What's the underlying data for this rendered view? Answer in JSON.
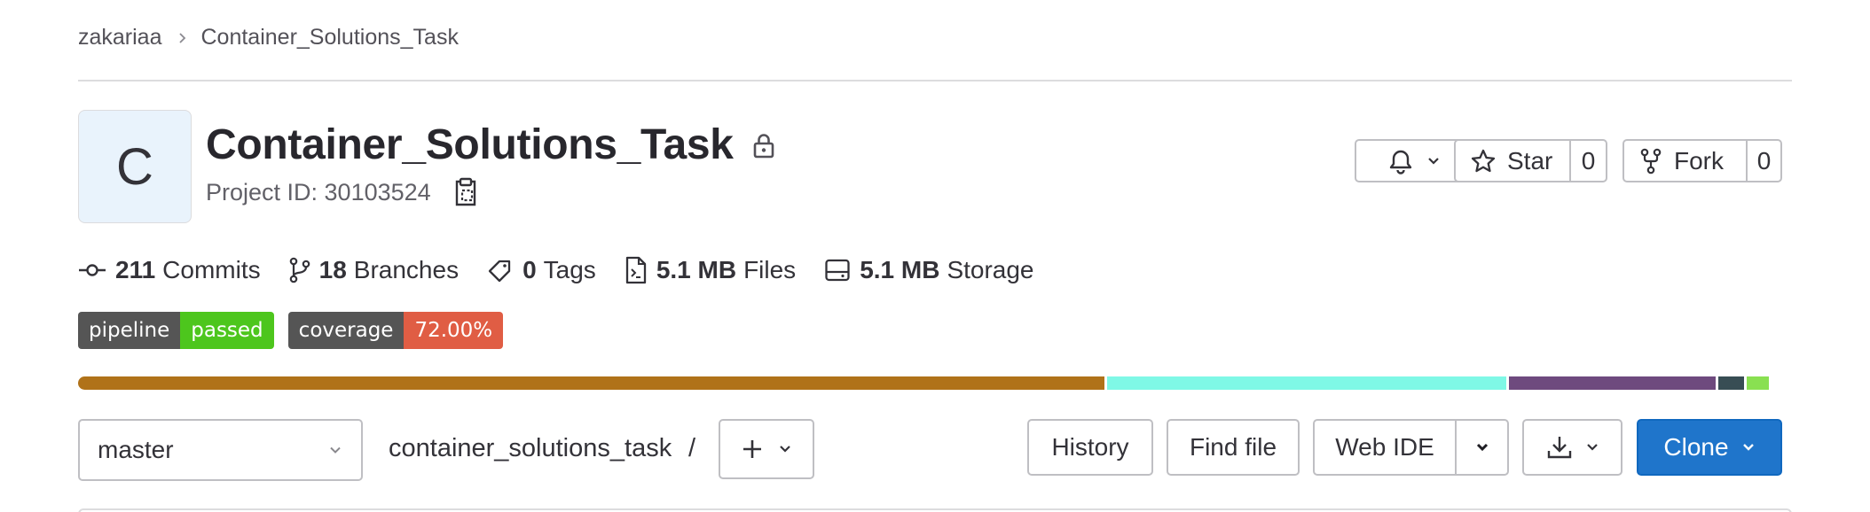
{
  "breadcrumb": {
    "owner": "zakariaa",
    "project": "Container_Solutions_Task"
  },
  "project": {
    "avatar_letter": "C",
    "title": "Container_Solutions_Task",
    "id_text": "Project ID: 30103524",
    "visibility_icon": "lock-icon"
  },
  "actions": {
    "notifications_icon": "bell-icon",
    "star_label": "Star",
    "star_count": "0",
    "fork_label": "Fork",
    "fork_count": "0"
  },
  "stats": {
    "commits_count": "211",
    "commits_label": "Commits",
    "branches_count": "18",
    "branches_label": "Branches",
    "tags_count": "0",
    "tags_label": "Tags",
    "files_size": "5.1 MB",
    "files_label": "Files",
    "storage_size": "5.1 MB",
    "storage_label": "Storage"
  },
  "badges": {
    "pipeline": {
      "key": "pipeline",
      "value": "passed",
      "value_color": "#4dc61d"
    },
    "coverage": {
      "key": "coverage",
      "value": "72.00%",
      "value_color": "#e05d44"
    }
  },
  "languages": [
    {
      "color": "#b07219",
      "share": 0.606
    },
    {
      "color": "#7ff8e6",
      "share": 0.236
    },
    {
      "color": "#6e4a7e",
      "share": 0.122
    },
    {
      "color": "#384d54",
      "share": 0.015
    },
    {
      "color": "#89e051",
      "share": 0.013
    }
  ],
  "toolbar": {
    "branch": "master",
    "path": "container_solutions_task",
    "path_separator": "/",
    "history_label": "History",
    "find_file_label": "Find file",
    "web_ide_label": "Web IDE",
    "clone_label": "Clone"
  },
  "colors": {
    "primary": "#1f75cb",
    "border": "#bfbfc3",
    "text": "#333238"
  }
}
